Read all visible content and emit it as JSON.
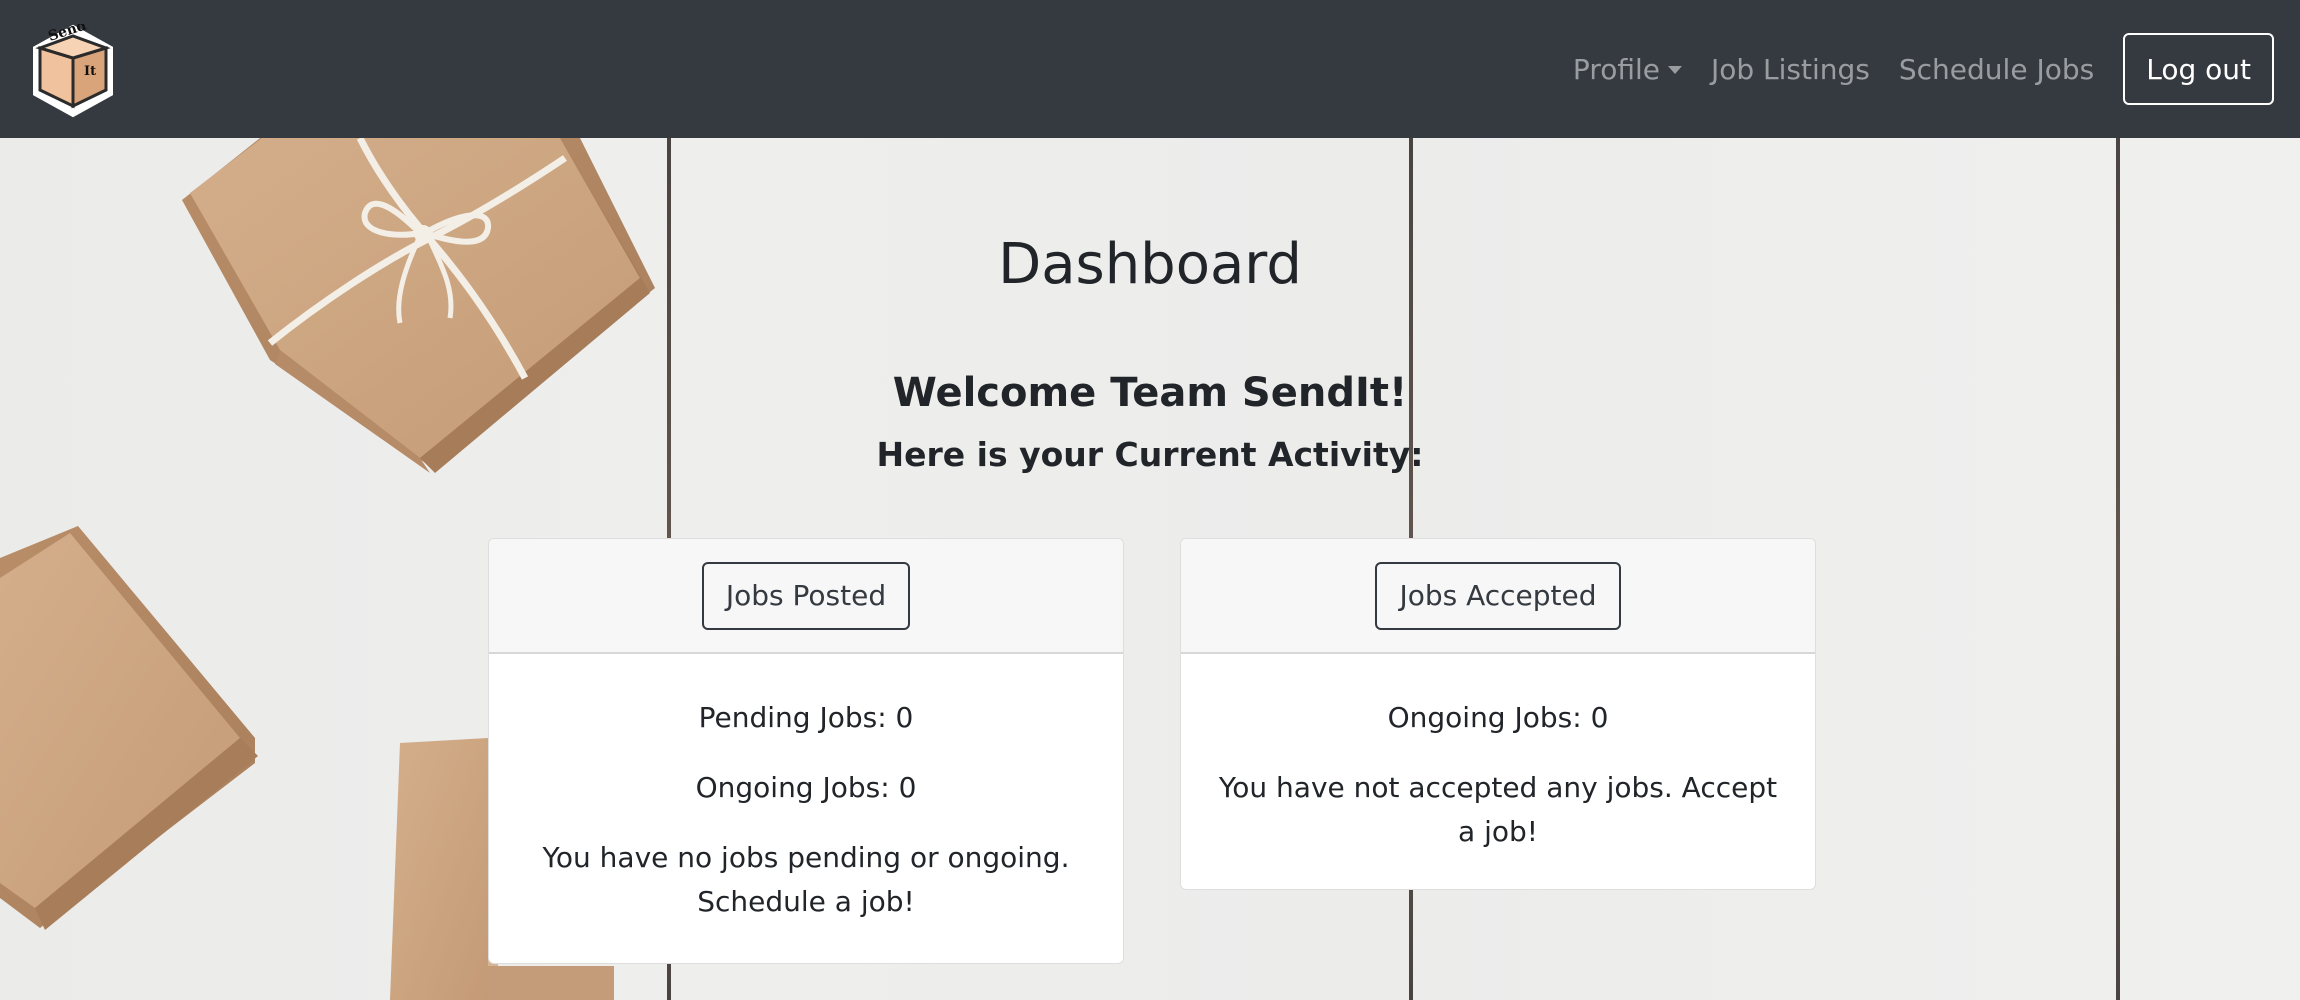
{
  "navbar": {
    "brand_logo_text": [
      "Send",
      "It"
    ],
    "links": [
      {
        "label": "Profile",
        "has_dropdown": true
      },
      {
        "label": "Job Listings"
      },
      {
        "label": "Schedule Jobs"
      }
    ],
    "logout_label": "Log out"
  },
  "dashboard": {
    "title": "Dashboard",
    "welcome": "Welcome Team SendIt!",
    "subtitle": "Here is your Current Activity:"
  },
  "cards": {
    "posted": {
      "button_label": "Jobs Posted",
      "pending": "Pending Jobs: 0",
      "ongoing": "Ongoing Jobs: 0",
      "message": "You have no jobs pending or ongoing. Schedule a job!"
    },
    "accepted": {
      "button_label": "Jobs Accepted",
      "ongoing": "Ongoing Jobs: 0",
      "message": "You have not accepted any jobs. Accept a job!"
    }
  },
  "colors": {
    "navbar_bg": "#343a40",
    "box_cardboard": "#c9a27e",
    "string": "#f3eee6"
  }
}
